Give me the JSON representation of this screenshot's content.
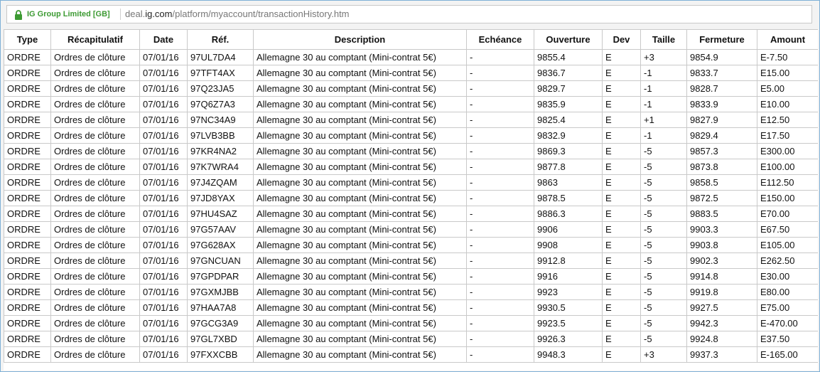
{
  "browser": {
    "cert_label": "IG Group Limited [GB]",
    "url_prefix": "deal.",
    "url_domain": "ig.com",
    "url_path": "/platform/myaccount/transactionHistory.htm"
  },
  "table": {
    "headers": [
      "Type",
      "Récapitulatif",
      "Date",
      "Réf.",
      "Description",
      "Echéance",
      "Ouverture",
      "Dev",
      "Taille",
      "Fermeture",
      "Amount"
    ],
    "rows": [
      [
        "ORDRE",
        "Ordres de clôture",
        "07/01/16",
        "97UL7DA4",
        "Allemagne 30 au comptant (Mini-contrat 5€)",
        "-",
        "9855.4",
        "E",
        "+3",
        "9854.9",
        "E-7.50"
      ],
      [
        "ORDRE",
        "Ordres de clôture",
        "07/01/16",
        "97TFT4AX",
        "Allemagne 30 au comptant (Mini-contrat 5€)",
        "-",
        "9836.7",
        "E",
        "-1",
        "9833.7",
        "E15.00"
      ],
      [
        "ORDRE",
        "Ordres de clôture",
        "07/01/16",
        "97Q23JA5",
        "Allemagne 30 au comptant (Mini-contrat 5€)",
        "-",
        "9829.7",
        "E",
        "-1",
        "9828.7",
        "E5.00"
      ],
      [
        "ORDRE",
        "Ordres de clôture",
        "07/01/16",
        "97Q6Z7A3",
        "Allemagne 30 au comptant (Mini-contrat 5€)",
        "-",
        "9835.9",
        "E",
        "-1",
        "9833.9",
        "E10.00"
      ],
      [
        "ORDRE",
        "Ordres de clôture",
        "07/01/16",
        "97NC34A9",
        "Allemagne 30 au comptant (Mini-contrat 5€)",
        "-",
        "9825.4",
        "E",
        "+1",
        "9827.9",
        "E12.50"
      ],
      [
        "ORDRE",
        "Ordres de clôture",
        "07/01/16",
        "97LVB3BB",
        "Allemagne 30 au comptant (Mini-contrat 5€)",
        "-",
        "9832.9",
        "E",
        "-1",
        "9829.4",
        "E17.50"
      ],
      [
        "ORDRE",
        "Ordres de clôture",
        "07/01/16",
        "97KR4NA2",
        "Allemagne 30 au comptant (Mini-contrat 5€)",
        "-",
        "9869.3",
        "E",
        "-5",
        "9857.3",
        "E300.00"
      ],
      [
        "ORDRE",
        "Ordres de clôture",
        "07/01/16",
        "97K7WRA4",
        "Allemagne 30 au comptant (Mini-contrat 5€)",
        "-",
        "9877.8",
        "E",
        "-5",
        "9873.8",
        "E100.00"
      ],
      [
        "ORDRE",
        "Ordres de clôture",
        "07/01/16",
        "97J4ZQAM",
        "Allemagne 30 au comptant (Mini-contrat 5€)",
        "-",
        "9863",
        "E",
        "-5",
        "9858.5",
        "E112.50"
      ],
      [
        "ORDRE",
        "Ordres de clôture",
        "07/01/16",
        "97JD8YAX",
        "Allemagne 30 au comptant (Mini-contrat 5€)",
        "-",
        "9878.5",
        "E",
        "-5",
        "9872.5",
        "E150.00"
      ],
      [
        "ORDRE",
        "Ordres de clôture",
        "07/01/16",
        "97HU4SAZ",
        "Allemagne 30 au comptant (Mini-contrat 5€)",
        "-",
        "9886.3",
        "E",
        "-5",
        "9883.5",
        "E70.00"
      ],
      [
        "ORDRE",
        "Ordres de clôture",
        "07/01/16",
        "97G57AAV",
        "Allemagne 30 au comptant (Mini-contrat 5€)",
        "-",
        "9906",
        "E",
        "-5",
        "9903.3",
        "E67.50"
      ],
      [
        "ORDRE",
        "Ordres de clôture",
        "07/01/16",
        "97G628AX",
        "Allemagne 30 au comptant (Mini-contrat 5€)",
        "-",
        "9908",
        "E",
        "-5",
        "9903.8",
        "E105.00"
      ],
      [
        "ORDRE",
        "Ordres de clôture",
        "07/01/16",
        "97GNCUAN",
        "Allemagne 30 au comptant (Mini-contrat 5€)",
        "-",
        "9912.8",
        "E",
        "-5",
        "9902.3",
        "E262.50"
      ],
      [
        "ORDRE",
        "Ordres de clôture",
        "07/01/16",
        "97GPDPAR",
        "Allemagne 30 au comptant (Mini-contrat 5€)",
        "-",
        "9916",
        "E",
        "-5",
        "9914.8",
        "E30.00"
      ],
      [
        "ORDRE",
        "Ordres de clôture",
        "07/01/16",
        "97GXMJBB",
        "Allemagne 30 au comptant (Mini-contrat 5€)",
        "-",
        "9923",
        "E",
        "-5",
        "9919.8",
        "E80.00"
      ],
      [
        "ORDRE",
        "Ordres de clôture",
        "07/01/16",
        "97HAA7A8",
        "Allemagne 30 au comptant (Mini-contrat 5€)",
        "-",
        "9930.5",
        "E",
        "-5",
        "9927.5",
        "E75.00"
      ],
      [
        "ORDRE",
        "Ordres de clôture",
        "07/01/16",
        "97GCG3A9",
        "Allemagne 30 au comptant (Mini-contrat 5€)",
        "-",
        "9923.5",
        "E",
        "-5",
        "9942.3",
        "E-470.00"
      ],
      [
        "ORDRE",
        "Ordres de clôture",
        "07/01/16",
        "97GL7XBD",
        "Allemagne 30 au comptant (Mini-contrat 5€)",
        "-",
        "9926.3",
        "E",
        "-5",
        "9924.8",
        "E37.50"
      ],
      [
        "ORDRE",
        "Ordres de clôture",
        "07/01/16",
        "97FXXCBB",
        "Allemagne 30 au comptant (Mini-contrat 5€)",
        "-",
        "9948.3",
        "E",
        "+3",
        "9937.3",
        "E-165.00"
      ]
    ]
  },
  "icons": {
    "lock": "lock-icon",
    "lock_color": "#3c9a32"
  }
}
